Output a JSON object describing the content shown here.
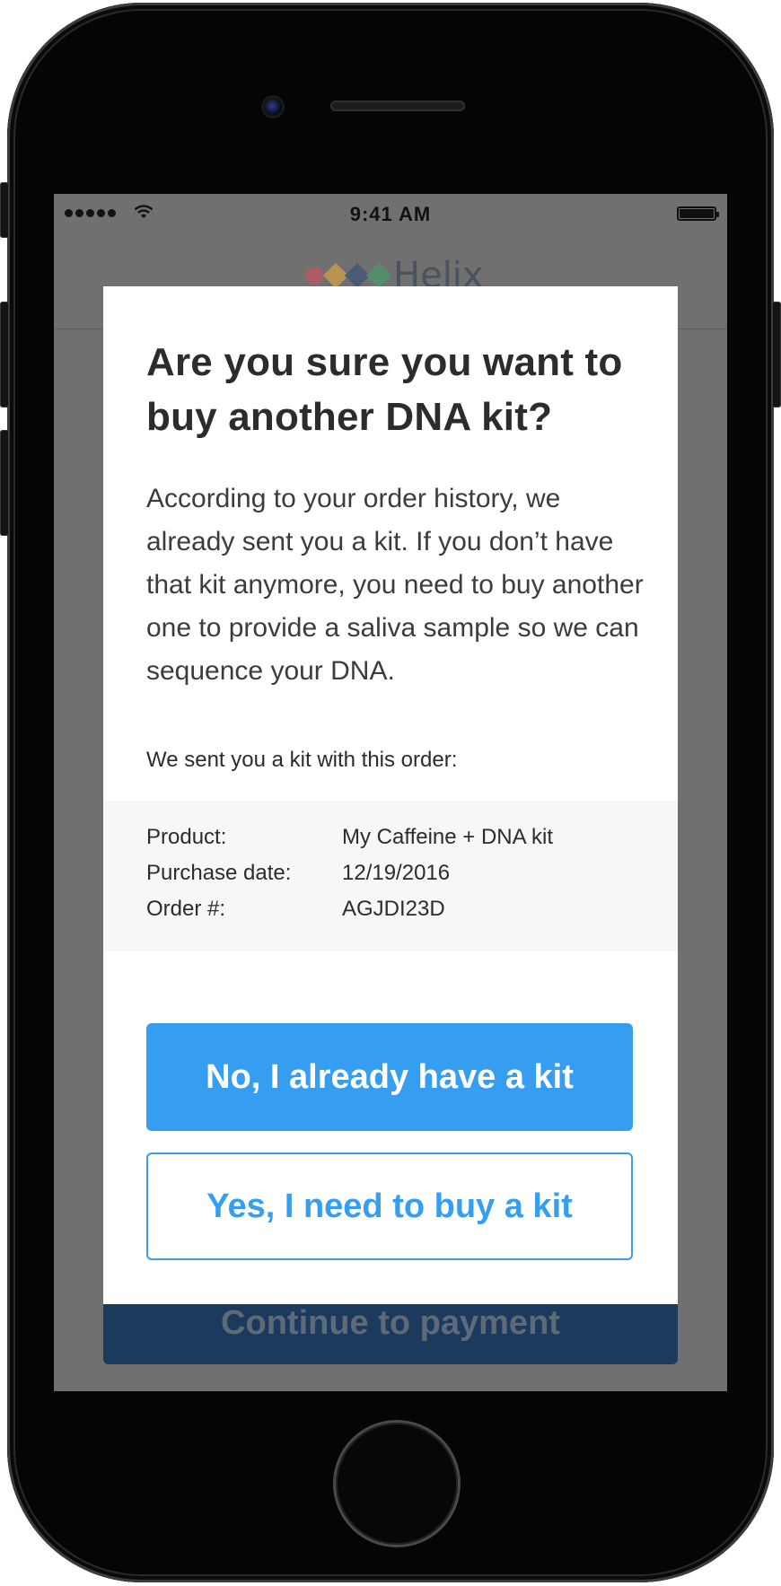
{
  "status_bar": {
    "time": "9:41 AM"
  },
  "app_header": {
    "brand": "Helix",
    "brand_colors": [
      "#e04a5f",
      "#f2b33a",
      "#2b4a7a",
      "#3aa56a"
    ]
  },
  "background_cta": {
    "label": "Continue to payment"
  },
  "modal": {
    "title": "Are you sure you want to buy another DNA kit?",
    "body": "According to your order history, we already sent you a kit. If you don’t have that kit anymore, you need to buy another one to provide a saliva sample so we can sequence your DNA.",
    "order_intro": "We sent you a kit with this order:",
    "order": [
      {
        "label": "Product:",
        "value": "My Caffeine + DNA kit"
      },
      {
        "label": "Purchase date:",
        "value": "12/19/2016"
      },
      {
        "label": "Order #:",
        "value": "AGJDI23D"
      }
    ],
    "primary_button": "No, I already have a kit",
    "secondary_button": "Yes, I need to buy a kit"
  },
  "colors": {
    "accent": "#369ef1",
    "overlay": "#707070",
    "cta_dimmed": "#1b3a5e"
  }
}
